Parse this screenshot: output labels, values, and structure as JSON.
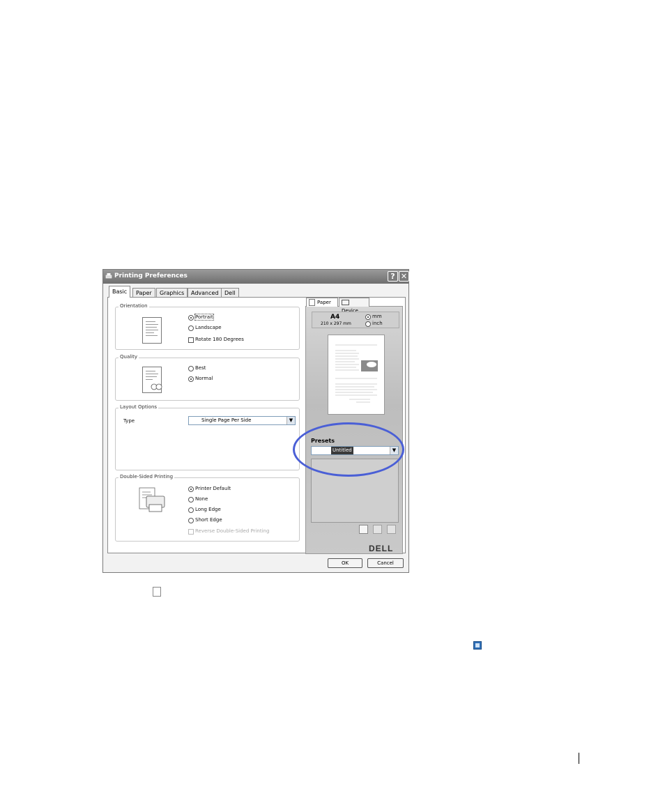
{
  "window": {
    "title": "Printing Preferences",
    "help_btn": "?",
    "close_btn": "✕"
  },
  "tabs": [
    {
      "label": "Basic",
      "active": true
    },
    {
      "label": "Paper"
    },
    {
      "label": "Graphics"
    },
    {
      "label": "Advanced"
    },
    {
      "label": "Dell"
    }
  ],
  "orientation": {
    "title": "Orientation",
    "portrait": "Portrait",
    "landscape": "Landscape",
    "rotate": "Rotate 180 Degrees",
    "selected": "Portrait"
  },
  "quality": {
    "title": "Quality",
    "best": "Best",
    "normal": "Normal",
    "selected": "Normal"
  },
  "layout": {
    "title": "Layout Options",
    "type_label": "Type",
    "type_value": "Single Page Per Side"
  },
  "duplex": {
    "title": "Double-Sided Printing",
    "printer_default": "Printer Default",
    "none": "None",
    "long_edge": "Long Edge",
    "short_edge": "Short Edge",
    "reverse": "Reverse Double-Sided Printing",
    "selected": "Printer Default"
  },
  "preview": {
    "tab_paper": "Paper",
    "tab_device": "Device",
    "paper_size": "A4",
    "paper_dims": "210 x 297 mm",
    "unit_mm": "mm",
    "unit_inch": "inch",
    "unit_selected": "mm"
  },
  "presets": {
    "label": "Presets",
    "value": "Untitled"
  },
  "brand": "DELL",
  "buttons": {
    "ok": "OK",
    "cancel": "Cancel"
  },
  "colors": {
    "highlight": "#4a5fd6",
    "titlebar": "#7c7c7c"
  }
}
